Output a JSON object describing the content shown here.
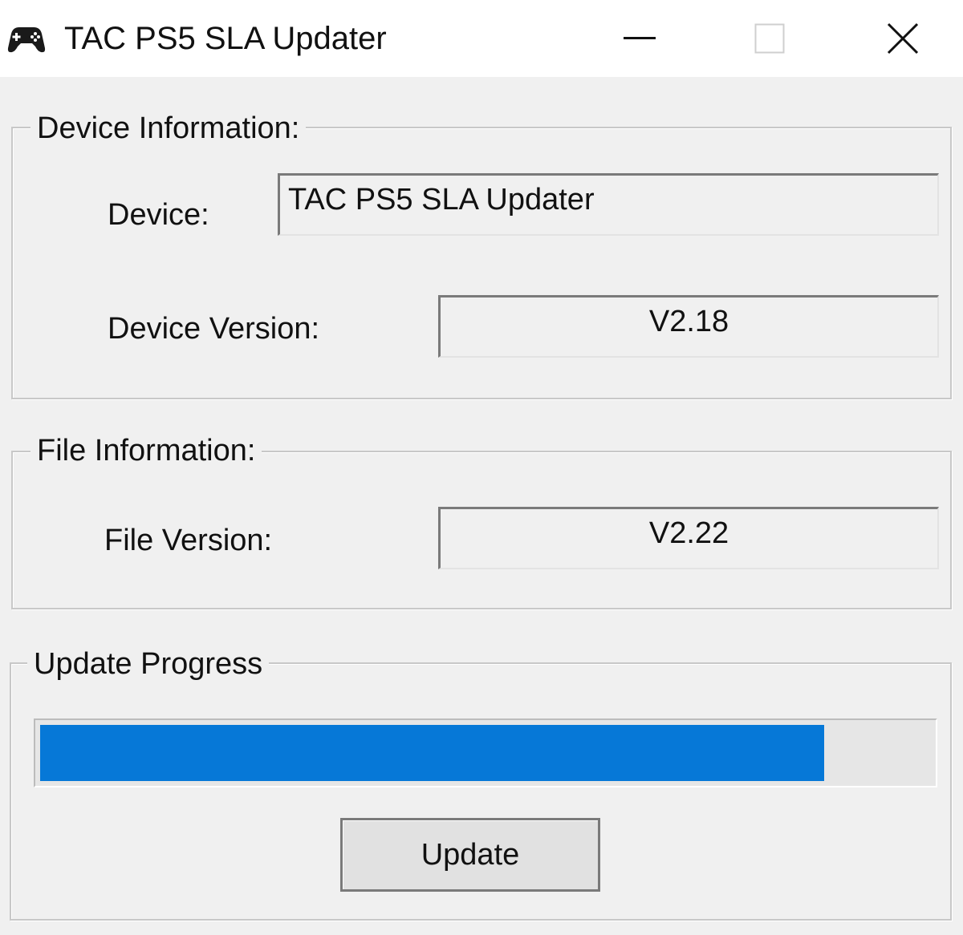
{
  "window": {
    "title": "TAC PS5 SLA Updater",
    "icon": "gamepad-icon",
    "controls": {
      "minimize": "minimize-icon",
      "maximize": "maximize-icon",
      "close": "close-icon"
    }
  },
  "device_info": {
    "legend": "Device Information:",
    "device_label": "Device:",
    "device_value": "TAC PS5 SLA Updater",
    "version_label": "Device Version:",
    "version_value": "V2.18"
  },
  "file_info": {
    "legend": "File Information:",
    "version_label": "File Version:",
    "version_value": "V2.22"
  },
  "update": {
    "legend": "Update Progress",
    "progress_fraction": 0.88,
    "progress_color": "#0678d7",
    "button_label": "Update"
  }
}
